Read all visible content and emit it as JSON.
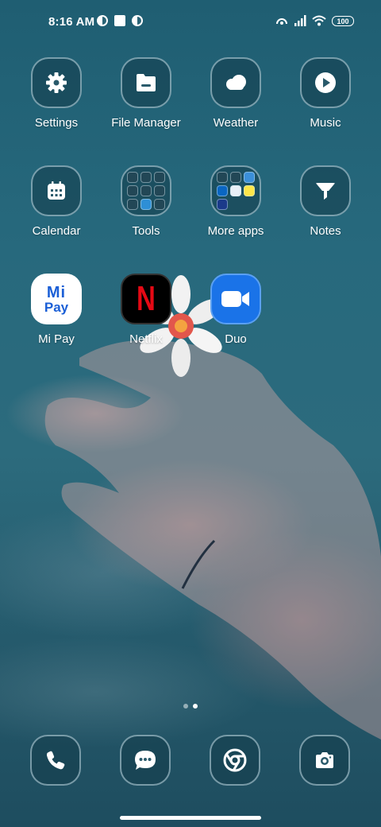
{
  "status_bar": {
    "time": "8:16 AM",
    "battery": "100"
  },
  "apps": [
    {
      "label": "Settings",
      "icon": "gear-icon"
    },
    {
      "label": "File Manager",
      "icon": "folder-icon"
    },
    {
      "label": "Weather",
      "icon": "cloud-icon"
    },
    {
      "label": "Music",
      "icon": "play-icon"
    },
    {
      "label": "Calendar",
      "icon": "calendar-icon"
    },
    {
      "label": "Tools",
      "icon": "folder-tools"
    },
    {
      "label": "More apps",
      "icon": "folder-more-apps"
    },
    {
      "label": "Notes",
      "icon": "notes-icon"
    },
    {
      "label": "Mi Pay",
      "icon": "mi-pay-icon"
    },
    {
      "label": "Netflix",
      "icon": "netflix-icon"
    },
    {
      "label": "Duo",
      "icon": "duo-camera-icon"
    }
  ],
  "mi_pay_logo": {
    "top": "Mi",
    "bottom": "Pay"
  },
  "netflix_logo": "N",
  "dock": [
    {
      "icon": "phone-icon"
    },
    {
      "icon": "messages-icon"
    },
    {
      "icon": "chrome-icon"
    },
    {
      "icon": "camera-icon"
    }
  ],
  "page_indicator": {
    "pages": 2,
    "current": 2
  },
  "colors": {
    "tile_bg": "#1e4b5c",
    "tile_border": "#c8e1eb",
    "netflix_red": "#e50914",
    "duo_blue": "#1a73e8",
    "mi_pay_blue": "#1b5fd6"
  }
}
